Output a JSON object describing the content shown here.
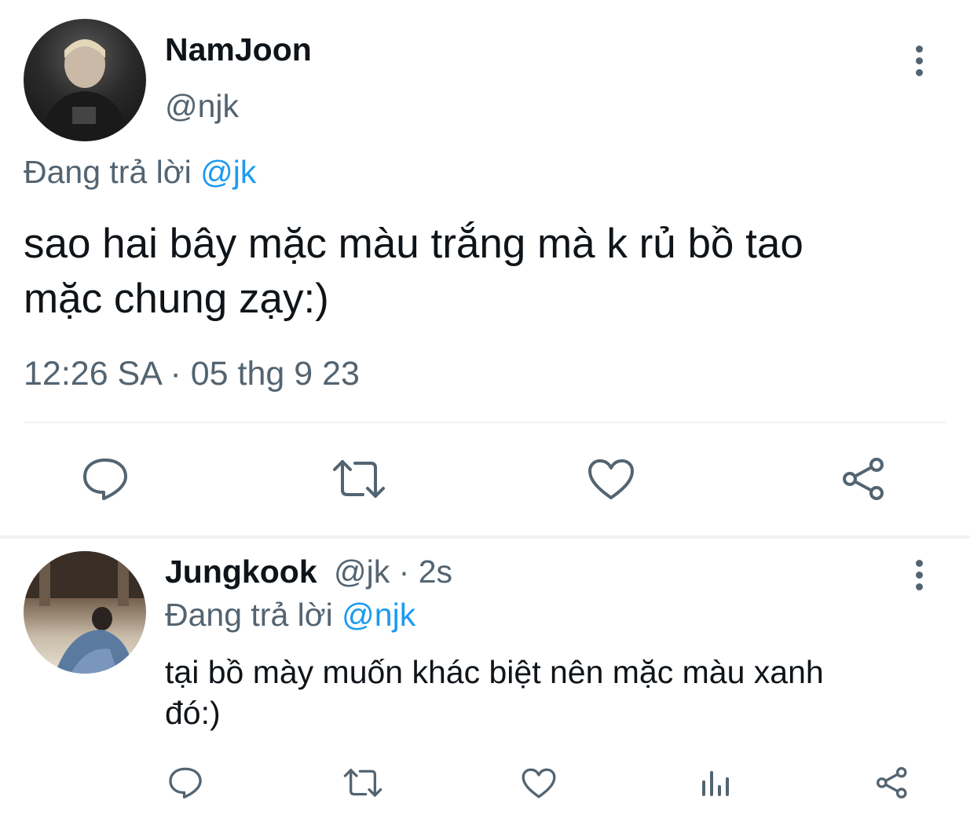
{
  "tweet": {
    "display_name": "NamJoon",
    "handle": "@njk",
    "reply_prefix": "Đang trả lời",
    "reply_to": "@jk",
    "text_line1": "sao hai bây mặc màu trắng mà k rủ bồ tao",
    "text_line2": "mặc chung zạy:)",
    "timestamp": "12:26 SA · 05 thg 9 23"
  },
  "reply": {
    "display_name": "Jungkook",
    "meta": "@jk · 2s",
    "reply_prefix": "Đang trả lời",
    "reply_to": "@njk",
    "text_line1": "tại bồ mày muốn khác biệt nên mặc màu xanh",
    "text_line2": "đó:)"
  },
  "icons": {
    "more": "more-vertical-icon",
    "reply": "reply-bubble-icon",
    "retweet": "retweet-icon",
    "like": "heart-icon",
    "views": "analytics-icon",
    "share": "share-icon"
  },
  "colors": {
    "link": "#1d9bf0",
    "muted": "#536471",
    "text": "#0f1419",
    "divider": "#eff3f4"
  }
}
